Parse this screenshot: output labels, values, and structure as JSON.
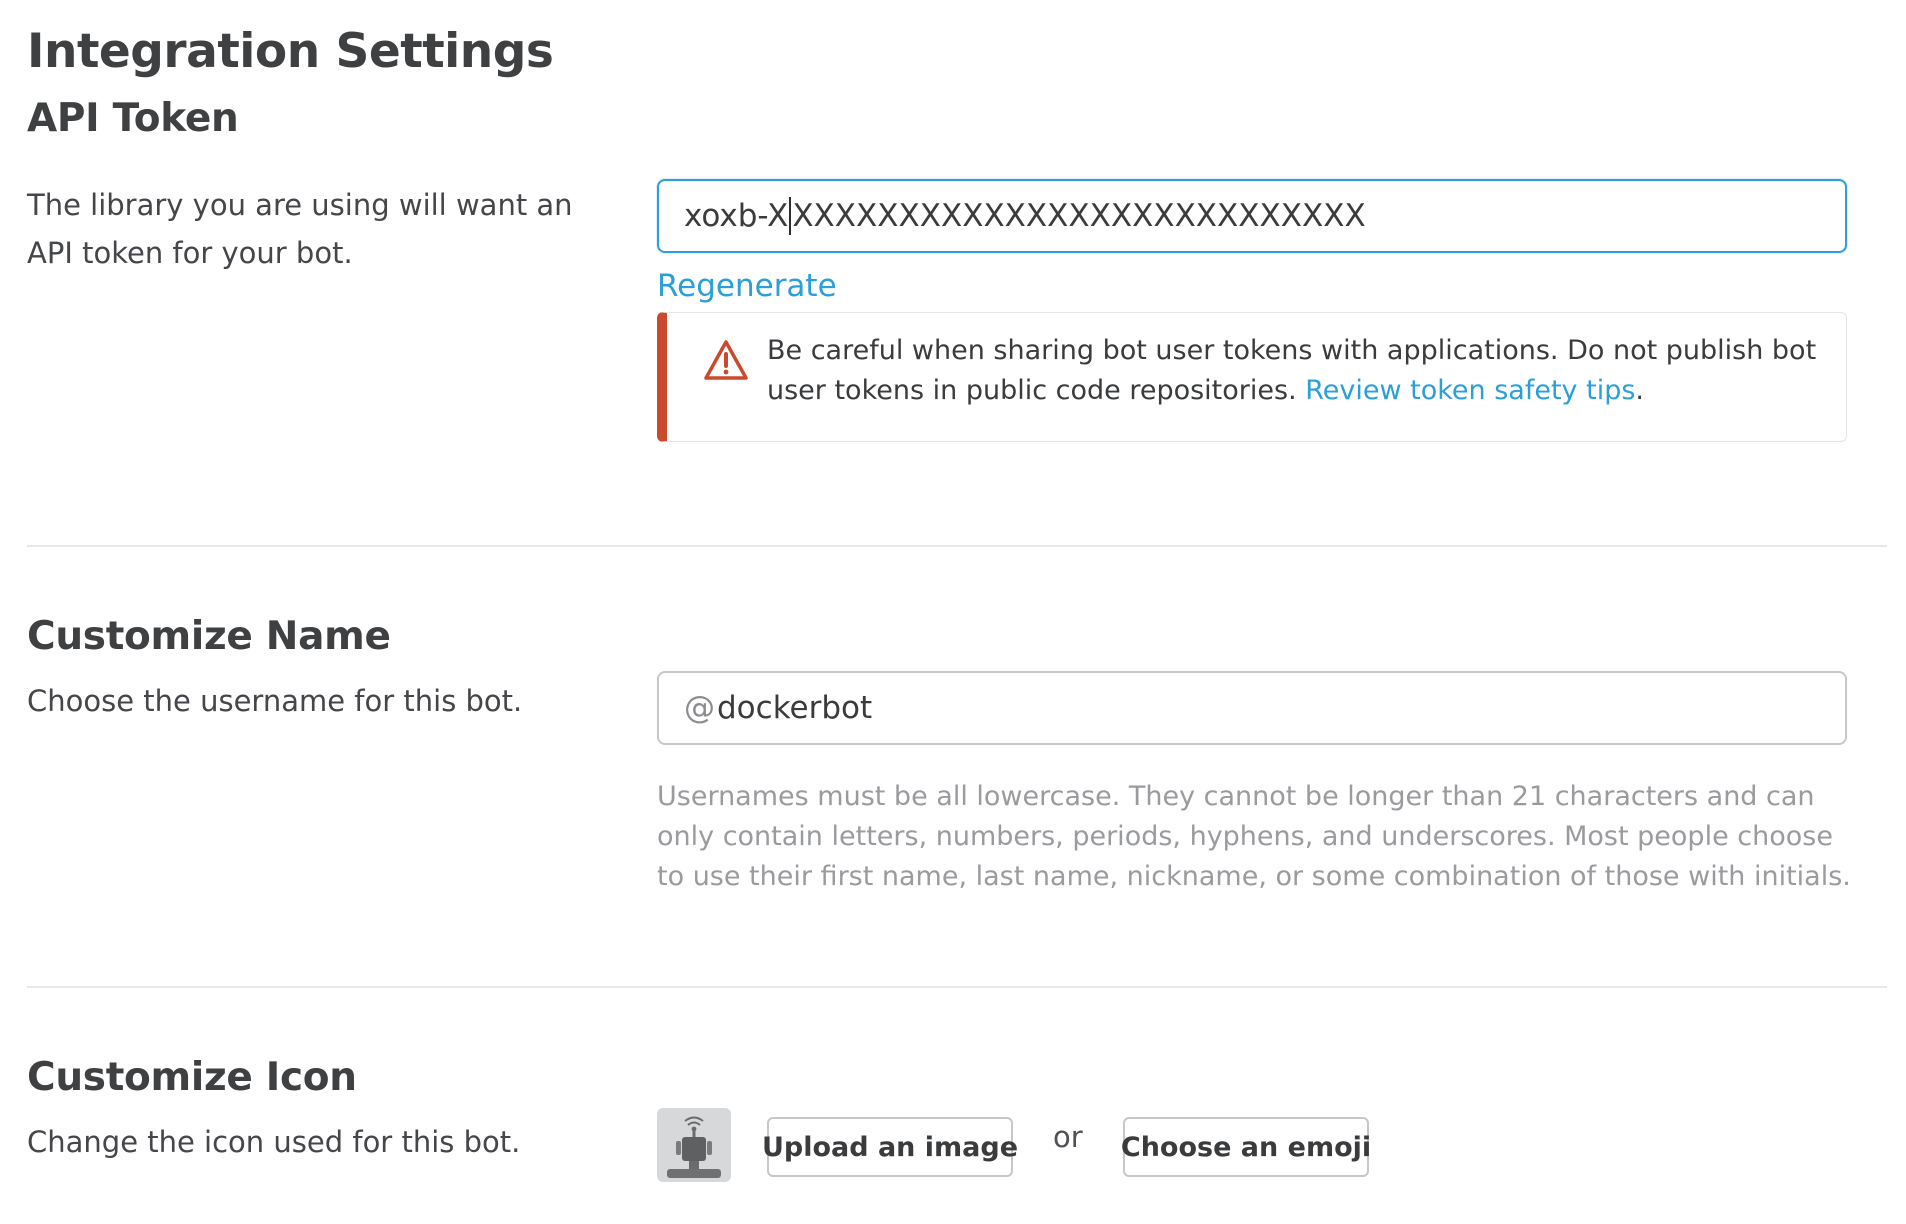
{
  "page": {
    "title": "Integration Settings"
  },
  "api_token": {
    "title": "API Token",
    "description": "The library you are using will want an API token for your bot.",
    "token_prefix": "xoxb-X",
    "token_rest": "XXXXXXXXXXXXXXXXXXXXXXXXXXX",
    "regenerate_label": "Regenerate",
    "warning": {
      "text": "Be careful when sharing bot user tokens with applications. Do not publish bot user tokens in public code repositories. ",
      "link_label": "Review token safety tips",
      "suffix": ".",
      "icon": "warning-triangle-icon",
      "accent_color": "#c94a2c"
    }
  },
  "customize_name": {
    "title": "Customize Name",
    "description": "Choose the username for this bot.",
    "at_symbol": "@",
    "username": "dockerbot",
    "help_text": "Usernames must be all lowercase. They cannot be longer than 21 characters and can only contain letters, numbers, periods, hyphens, and underscores. Most people choose to use their first name, last name, nickname, or some combination of those with initials."
  },
  "customize_icon": {
    "title": "Customize Icon",
    "description": "Change the icon used for this bot.",
    "avatar_icon": "bot-avatar-icon",
    "upload_label": "Upload an image",
    "or_label": "or",
    "emoji_label": "Choose an emoji"
  },
  "colors": {
    "link": "#2a9fd8",
    "focus_border": "#2d9ee0",
    "warning_red": "#c94a2c"
  }
}
